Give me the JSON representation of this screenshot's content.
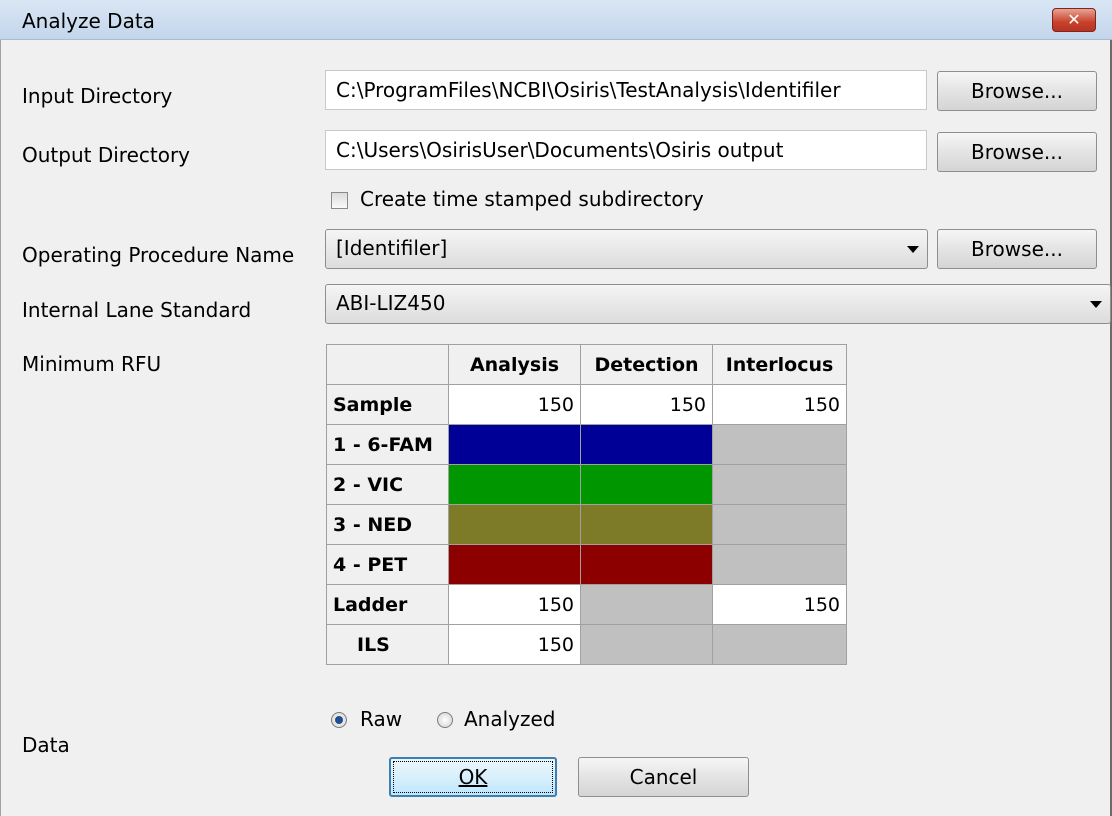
{
  "window": {
    "title": "Analyze Data",
    "close_label": "✕"
  },
  "input_directory": {
    "label": "Input Directory",
    "value": "C:\\ProgramFiles\\NCBI\\Osiris\\TestAnalysis\\Identifiler",
    "browse_label": "Browse..."
  },
  "output_directory": {
    "label": "Output Directory",
    "value": "C:\\Users\\OsirisUser\\Documents\\Osiris output",
    "browse_label": "Browse..."
  },
  "timestamp_checkbox": {
    "label": "Create time stamped subdirectory",
    "checked": false
  },
  "operating_procedure": {
    "label": "Operating Procedure Name",
    "value": "[Identifiler]",
    "browse_label": "Browse..."
  },
  "internal_lane_standard": {
    "label": "Internal Lane Standard",
    "value": "ABI-LIZ450"
  },
  "minimum_rfu": {
    "label": "Minimum RFU",
    "columns": [
      "Analysis",
      "Detection",
      "Interlocus"
    ],
    "sample": {
      "label": "Sample",
      "analysis": "150",
      "detection": "150",
      "interlocus": "150"
    },
    "channels": [
      {
        "label": "1 - 6-FAM",
        "color": "#000096"
      },
      {
        "label": "2 - VIC",
        "color": "#009600"
      },
      {
        "label": "3 - NED",
        "color": "#7d7a28"
      },
      {
        "label": "4 - PET",
        "color": "#8c0000"
      }
    ],
    "ladder": {
      "label": "Ladder",
      "analysis": "150",
      "interlocus": "150"
    },
    "ils": {
      "label": "ILS",
      "analysis": "150"
    }
  },
  "data": {
    "label": "Data",
    "options": [
      "Raw",
      "Analyzed"
    ],
    "selected": "Raw"
  },
  "buttons": {
    "ok": "OK",
    "cancel": "Cancel"
  },
  "colors": {
    "neutral_cell": "#c0c0c0"
  }
}
